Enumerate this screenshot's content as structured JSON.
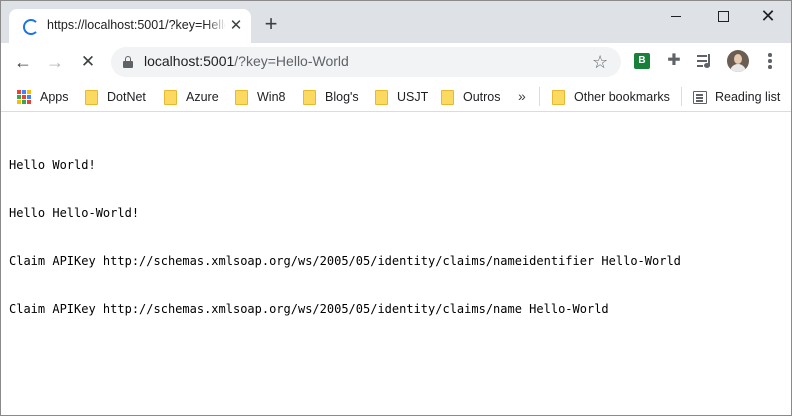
{
  "tab": {
    "title": "https://localhost:5001/?key=Hello-World",
    "close_glyph": "✕",
    "new_tab_glyph": "+"
  },
  "window_controls": {
    "close_glyph": "✕"
  },
  "toolbar": {
    "back_glyph": "←",
    "forward_glyph": "→",
    "stop_glyph": "✕",
    "url_host": "localhost:5001",
    "url_path": "/?key=Hello-World",
    "star_glyph": "☆",
    "extension_b": "B",
    "puzzle_glyph": "✚"
  },
  "bookmarks": {
    "apps": "Apps",
    "items": [
      {
        "label": "DotNet"
      },
      {
        "label": "Azure"
      },
      {
        "label": "Win8"
      },
      {
        "label": "Blog's"
      },
      {
        "label": "USJT"
      },
      {
        "label": "Outros"
      }
    ],
    "more_glyph": "»",
    "other": "Other bookmarks",
    "reading_list": "Reading list"
  },
  "page": {
    "lines": [
      "Hello World!",
      "Hello Hello-World!",
      "Claim APIKey http://schemas.xmlsoap.org/ws/2005/05/identity/claims/nameidentifier Hello-World",
      "Claim APIKey http://schemas.xmlsoap.org/ws/2005/05/identity/claims/name Hello-World"
    ]
  },
  "colors": {
    "tabstrip_bg": "#dee1e6",
    "omnibox_bg": "#f1f3f4",
    "spinner": "#1a73e8",
    "folder": "#fcd961",
    "extension_green": "#188038"
  }
}
